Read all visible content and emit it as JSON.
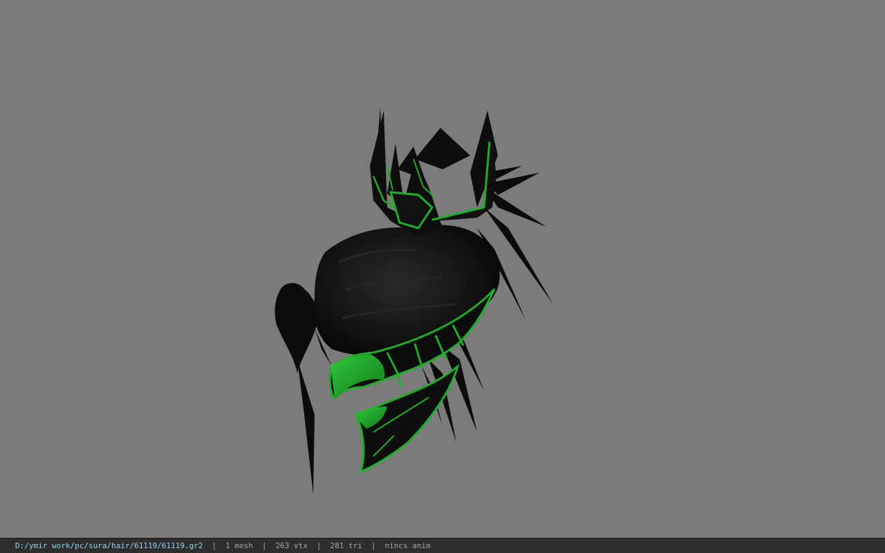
{
  "viewer": {
    "background_color": "#7b7b7b",
    "model_name": "61119.gr2",
    "accent_color": "#1fae2a"
  },
  "statusbar": {
    "file_path": "D:/ymir work/pc/sura/hair/61119/61119.gr2",
    "mesh_count": "1 mesh",
    "vertex_count": "263 vtx",
    "triangle_count": "281 tri",
    "anim_status": "nincs anim",
    "separator": "|"
  }
}
